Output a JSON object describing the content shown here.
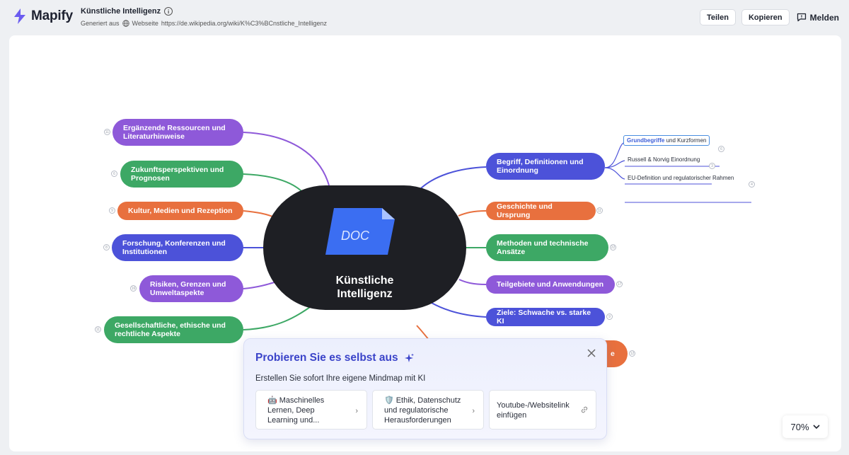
{
  "app": {
    "name": "Mapify"
  },
  "document": {
    "title": "Künstliche Intelligenz",
    "source_prefix": "Generiert aus",
    "source_type": "Webseite",
    "source_url": "https://de.wikipedia.org/wiki/K%C3%BCnstliche_Intelligenz"
  },
  "header_actions": {
    "share": "Teilen",
    "copy": "Kopieren",
    "report": "Melden"
  },
  "mindmap": {
    "center": {
      "label": "Künstliche\nIntelligenz",
      "badge": "DOC"
    },
    "left": [
      {
        "label": "Ergänzende Ressourcen und Literaturhinweise",
        "color": "#8e59d9"
      },
      {
        "label": "Zukunftsperspektiven und Prognosen",
        "color": "#3da865"
      },
      {
        "label": "Kultur, Medien und Rezeption",
        "color": "#e8703e"
      },
      {
        "label": "Forschung, Konferenzen und Institutionen",
        "color": "#4c52d9"
      },
      {
        "label": "Risiken, Grenzen und Umweltaspekte",
        "color": "#8e59d9"
      },
      {
        "label": "Gesellschaftliche, ethische und rechtliche Aspekte",
        "color": "#3da865"
      }
    ],
    "right": [
      {
        "label": "Begriff, Definitionen und Einordnung",
        "color": "#4c52d9"
      },
      {
        "label": "Geschichte und Ursprung",
        "color": "#e8703e"
      },
      {
        "label": "Methoden und technische Ansätze",
        "color": "#3da865"
      },
      {
        "label": "Teilgebiete und Anwendungen",
        "color": "#8e59d9"
      },
      {
        "label": "Ziele: Schwache vs. starke KI",
        "color": "#4c52d9"
      }
    ],
    "subnodes": [
      {
        "bold": "Grundbegriffe",
        "rest": " und Kurzformen"
      },
      {
        "label": "Russell & Norvig Einordnung"
      },
      {
        "label": "EU-Definition und regulatorischer Rahmen"
      }
    ]
  },
  "promo": {
    "title": "Probieren Sie es selbst aus",
    "subtitle": "Erstellen Sie sofort Ihre eigene Mindmap mit KI",
    "cards": [
      {
        "icon": "🤖",
        "label": "Maschinelles Lernen, Deep Learning und..."
      },
      {
        "icon": "🛡️",
        "label": "Ethik, Datenschutz und regulatorische Herausforderungen"
      },
      {
        "label": "Youtube-/Websitelink einfügen"
      }
    ]
  },
  "zoom": {
    "label": "70%"
  }
}
